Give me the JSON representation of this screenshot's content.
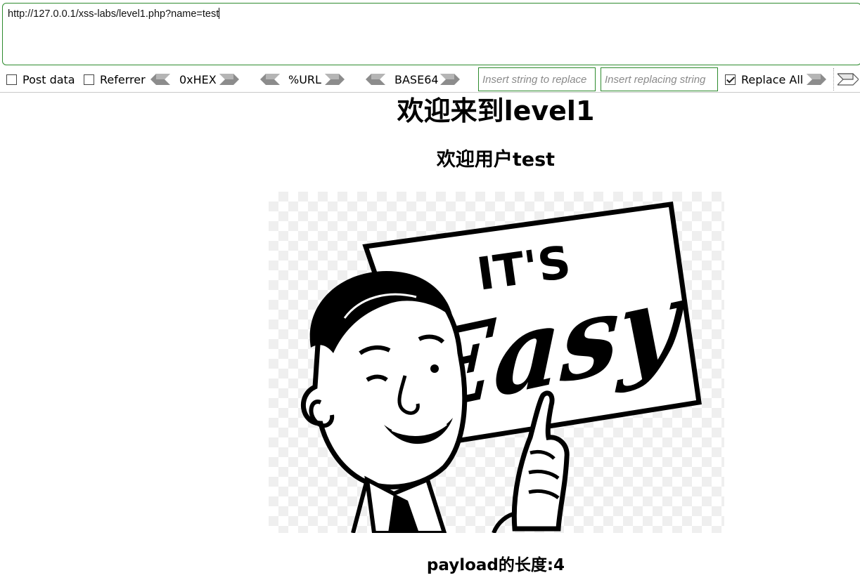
{
  "url_bar": {
    "value": "http://127.0.0.1/xss-labs/level1.php?name=test"
  },
  "toolbar": {
    "post_data_label": "Post data",
    "referrer_label": "Referrer",
    "hex_label": "0xHEX",
    "url_label": "%URL",
    "base64_label": "BASE64",
    "find_placeholder": "Insert string to replace",
    "replace_placeholder": "Insert replacing string",
    "replace_all_label": "Replace All",
    "post_data_checked": false,
    "referrer_checked": false,
    "replace_all_checked": true
  },
  "page": {
    "heading": "欢迎来到level1",
    "welcome": "欢迎用户test",
    "image_text_top": "IT'S",
    "image_text_main": "Easy",
    "payload_length": "payload的长度:4"
  },
  "colors": {
    "field_border": "#2e8b2e",
    "arrow_fill": "#8c8c8c"
  }
}
